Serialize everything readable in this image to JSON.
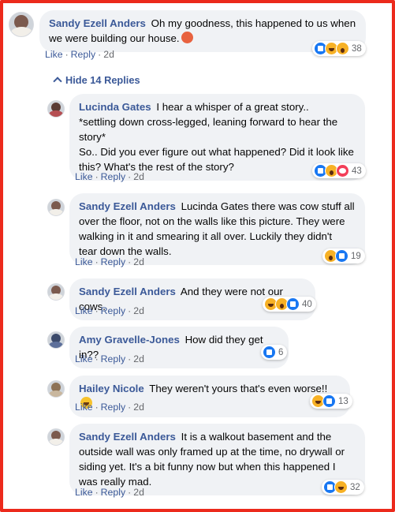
{
  "hide_replies": "Hide 14 Replies",
  "comments": [
    {
      "name": "Sandy Ezell Anders",
      "text": "Oh my goodness, this happened to us when we were building our house.",
      "like": "Like",
      "reply": "Reply",
      "time": "2d",
      "count": "38"
    },
    {
      "name": "Lucinda Gates",
      "text": "I hear a whisper of a great story.. *settling down cross-legged, leaning forward to hear the story* So.. Did you ever figure out what happened? Did it look like this? What's the rest of the story?",
      "like": "Like",
      "reply": "Reply",
      "time": "2d",
      "count": "43"
    },
    {
      "name": "Sandy Ezell Anders",
      "text": "Lucinda Gates there was cow stuff all over the floor, not on the walls like this picture. They were walking in it and smearing it all over. Luckily they didn't tear down the walls.",
      "like": "Like",
      "reply": "Reply",
      "time": "2d",
      "count": "19"
    },
    {
      "name": "Sandy Ezell Anders",
      "text": "And they were not our cows.",
      "like": "Like",
      "reply": "Reply",
      "time": "2d",
      "count": "40"
    },
    {
      "name": "Amy Gravelle-Jones",
      "text": "How did they get in??",
      "like": "Like",
      "reply": "Reply",
      "time": "2d",
      "count": "6"
    },
    {
      "name": "Hailey Nicole",
      "text": "They weren't yours that's even worse!!",
      "like": "Like",
      "reply": "Reply",
      "time": "2d",
      "count": "13"
    },
    {
      "name": "Sandy Ezell Anders",
      "text": "It is a walkout basement and the outside wall was only framed up at the time, no drywall or siding yet. It's a bit funny now but when this happened I was really mad.",
      "like": "Like",
      "reply": "Reply",
      "time": "2d",
      "count": "32"
    }
  ]
}
